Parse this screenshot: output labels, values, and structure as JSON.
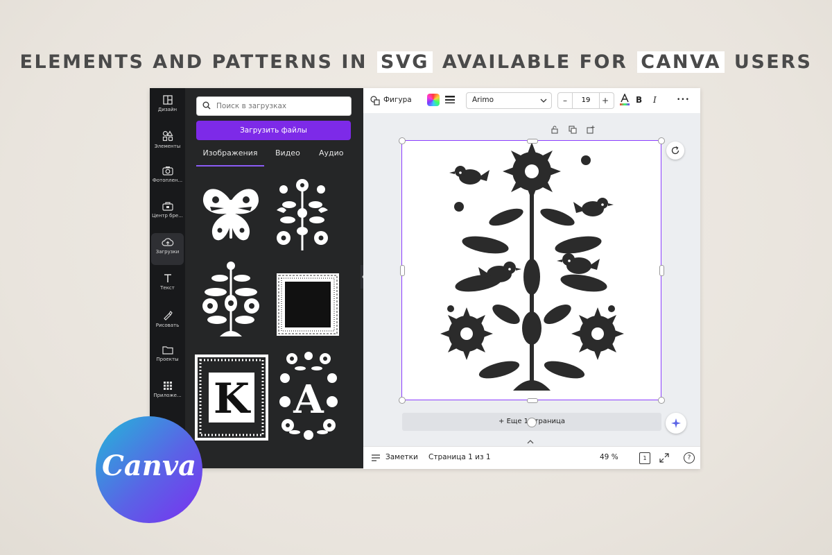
{
  "headline": {
    "before": "Elements and patterns in",
    "hl1": "SVG",
    "middle": "available for",
    "hl2": "Canva",
    "after": "users"
  },
  "sidebar": {
    "items": [
      {
        "label": "Дизайн",
        "icon": "layout-icon"
      },
      {
        "label": "Элементы",
        "icon": "shapes-icon"
      },
      {
        "label": "Фотоплен...",
        "icon": "camera-icon"
      },
      {
        "label": "Центр бре...",
        "icon": "brand-icon"
      },
      {
        "label": "Загрузки",
        "icon": "cloud-upload-icon"
      },
      {
        "label": "Текст",
        "icon": "text-icon"
      },
      {
        "label": "Рисовать",
        "icon": "draw-icon"
      },
      {
        "label": "Проекты",
        "icon": "folder-icon"
      },
      {
        "label": "Приложе...",
        "icon": "apps-icon"
      }
    ]
  },
  "panel": {
    "search_placeholder": "Поиск в загрузках",
    "upload_label": "Загрузить файлы",
    "tabs": [
      "Изображения",
      "Видео",
      "Аудио"
    ],
    "active_tab": "Изображения",
    "letters": [
      "K",
      "A"
    ]
  },
  "toolbar": {
    "shape_label": "Фигура",
    "font": "Arimo",
    "font_size": "19",
    "minus": "–",
    "plus": "+",
    "bold": "B",
    "italic": "I",
    "more": "•••"
  },
  "canvas": {
    "add_page_label": "+ Еще 1 страница"
  },
  "bottom": {
    "notes_label": "Заметки",
    "page_info": "Страница 1 из 1",
    "zoom": "49 %",
    "pages_count": "1",
    "help": "?"
  },
  "badge": {
    "text": "Canva"
  },
  "colors": {
    "accent": "#7d2ae8",
    "selection": "#8b3dff",
    "rail_bg": "#18191b",
    "panel_bg": "#252627"
  }
}
